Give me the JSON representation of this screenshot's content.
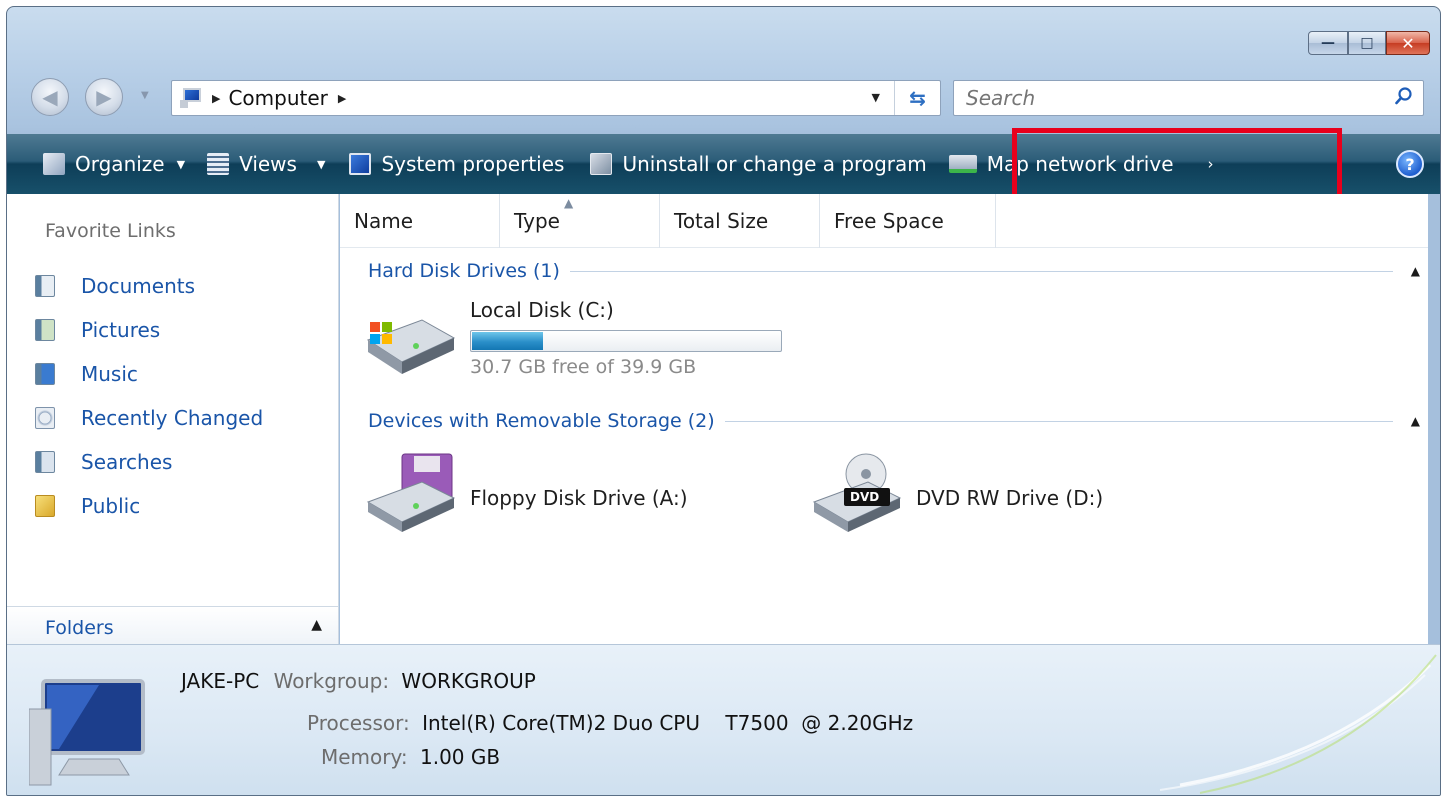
{
  "window": {
    "controls": {
      "minimize": "—",
      "maximize": "□",
      "close": "✕"
    }
  },
  "nav": {
    "breadcrumb": "Computer",
    "search_placeholder": "Search"
  },
  "commands": [
    {
      "label": "Organize",
      "icon": "organize-icon",
      "dropdown": true
    },
    {
      "label": "Views",
      "icon": "views-icon",
      "dropdown": true
    },
    {
      "label": "System properties",
      "icon": "system-properties-icon",
      "dropdown": false
    },
    {
      "label": "Uninstall or change a program",
      "icon": "uninstall-icon",
      "dropdown": false
    },
    {
      "label": "Map network drive",
      "icon": "network-drive-icon",
      "dropdown": false
    }
  ],
  "sidebar": {
    "title": "Favorite Links",
    "items": [
      {
        "label": "Documents",
        "icon": "documents-icon"
      },
      {
        "label": "Pictures",
        "icon": "pictures-icon"
      },
      {
        "label": "Music",
        "icon": "music-icon"
      },
      {
        "label": "Recently Changed",
        "icon": "recently-changed-icon"
      },
      {
        "label": "Searches",
        "icon": "searches-icon"
      },
      {
        "label": "Public",
        "icon": "public-folder-icon"
      }
    ],
    "folders_label": "Folders"
  },
  "columns": [
    "Name",
    "Type",
    "Total Size",
    "Free Space"
  ],
  "groups": [
    {
      "title": "Hard Disk Drives (1)",
      "drives": [
        {
          "name": "Local Disk (C:)",
          "free_text": "30.7 GB free of 39.9 GB",
          "used_fraction": 0.23
        }
      ]
    },
    {
      "title": "Devices with Removable Storage (2)",
      "drives": [
        {
          "name": "Floppy Disk Drive (A:)"
        },
        {
          "name": "DVD RW Drive (D:)",
          "badge": "DVD"
        }
      ]
    }
  ],
  "details": {
    "computer_name": "JAKE-PC",
    "workgroup_label": "Workgroup:",
    "workgroup": "WORKGROUP",
    "processor_label": "Processor:",
    "processor": "Intel(R) Core(TM)2 Duo CPU    T7500  @ 2.20GHz",
    "memory_label": "Memory:",
    "memory": "1.00 GB"
  },
  "colors": {
    "accent_link": "#1a55a8",
    "highlight": "#e8001c",
    "command_bar": "#17506a"
  }
}
